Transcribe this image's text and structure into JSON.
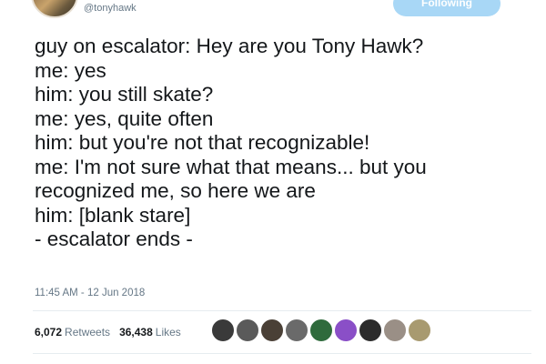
{
  "author": {
    "handle": "@tonyhawk",
    "avatar_icon": "profile-photo-icon"
  },
  "follow_button": {
    "label": "Following",
    "color": "#a8d7f6"
  },
  "tweet": {
    "lines": [
      "guy on escalator: Hey are you Tony Hawk?",
      "me: yes",
      "him: you still skate?",
      "me: yes, quite often",
      "him: but you're not that recognizable!",
      "me: I'm not sure what that means... but you",
      "recognized me, so here we are",
      "him: [blank stare]",
      "- escalator ends -"
    ],
    "timestamp": "11:45 AM - 12 Jun 2018"
  },
  "stats": {
    "retweets_count": "6,072",
    "retweets_label": "Retweets",
    "likes_count": "36,438",
    "likes_label": "Likes"
  },
  "likers": [
    {
      "icon": "user-avatar-icon",
      "glyph": "●",
      "color": "#3a3a3a"
    },
    {
      "icon": "user-avatar-icon",
      "glyph": "●",
      "color": "#5a5a5a"
    },
    {
      "icon": "user-avatar-icon",
      "glyph": "●",
      "color": "#4a4036"
    },
    {
      "icon": "user-avatar-icon",
      "glyph": "●",
      "color": "#6a6a6a"
    },
    {
      "icon": "user-avatar-icon",
      "glyph": "●",
      "color": "#2f6b3c"
    },
    {
      "icon": "user-avatar-icon",
      "glyph": "●",
      "color": "#8a4fc7"
    },
    {
      "icon": "user-avatar-icon",
      "glyph": "●",
      "color": "#2b2b2b"
    },
    {
      "icon": "user-avatar-icon",
      "glyph": "●",
      "color": "#9a8f86"
    },
    {
      "icon": "user-avatar-icon",
      "glyph": "●",
      "color": "#a89a70"
    }
  ],
  "colors": {
    "text": "#14171a",
    "secondary": "#657786",
    "divider": "#e6ecf0"
  }
}
